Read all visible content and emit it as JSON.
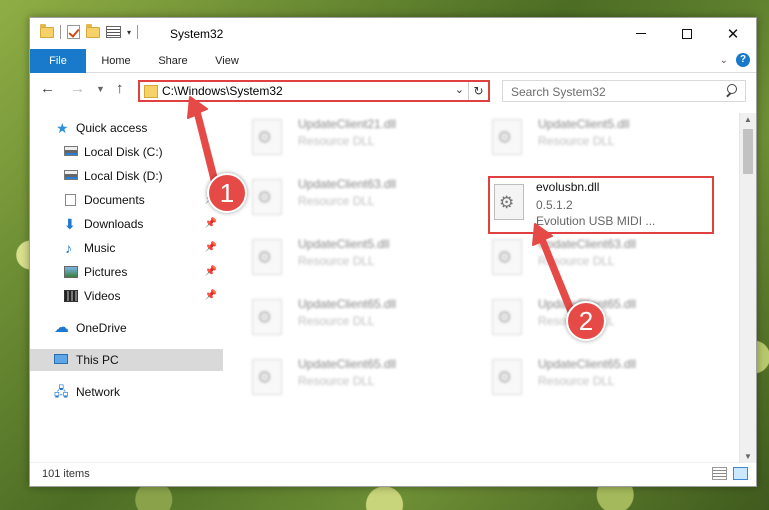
{
  "window": {
    "title": "System32"
  },
  "ribbon": {
    "tabs": [
      "File",
      "Home",
      "Share",
      "View"
    ],
    "help": "?"
  },
  "address": {
    "path": "C:\\Windows\\System32",
    "refresh_icon": "refresh-icon"
  },
  "search": {
    "placeholder": "Search System32"
  },
  "navpane": {
    "items": [
      {
        "label": "Quick access",
        "icon": "star-icon"
      },
      {
        "label": "Local Disk (C:)",
        "icon": "drive-icon"
      },
      {
        "label": "Local Disk (D:)",
        "icon": "drive-icon"
      },
      {
        "label": "Documents",
        "icon": "documents-icon",
        "pinned": true
      },
      {
        "label": "Downloads",
        "icon": "download-icon",
        "pinned": true
      },
      {
        "label": "Music",
        "icon": "music-icon",
        "pinned": true
      },
      {
        "label": "Pictures",
        "icon": "pictures-icon",
        "pinned": true
      },
      {
        "label": "Videos",
        "icon": "videos-icon",
        "pinned": true
      },
      {
        "label": "OneDrive",
        "icon": "cloud-icon"
      },
      {
        "label": "This PC",
        "icon": "computer-icon",
        "selected": true
      },
      {
        "label": "Network",
        "icon": "network-icon"
      }
    ]
  },
  "files": {
    "col1": [
      {
        "name": "UpdateClient21.dll",
        "desc": "Resource DLL"
      },
      {
        "name": "UpdateClient63.dll",
        "desc": "Resource DLL"
      },
      {
        "name": "UpdateClient5.dll",
        "desc": "Resource DLL"
      },
      {
        "name": "UpdateClient65.dll",
        "desc": "Resource DLL"
      },
      {
        "name": "UpdateClient65.dll",
        "desc": "Resource DLL"
      }
    ],
    "col2": [
      {
        "name": "UpdateClient5.dll",
        "desc": "Resource DLL"
      },
      {
        "name": "UpdateClient63.dll",
        "desc": "Resource DLL"
      },
      {
        "name": "UpdateClient65.dll",
        "desc": "Resource DLL"
      },
      {
        "name": "UpdateClient65.dll",
        "desc": "Resource DLL"
      }
    ],
    "highlighted": {
      "name": "evolusbn.dll",
      "version": "0.5.1.2",
      "desc": "Evolution USB MIDI ..."
    }
  },
  "status": {
    "count": "101 items"
  },
  "annotations": {
    "badge1": "1",
    "badge2": "2",
    "color": "#e64a47"
  }
}
